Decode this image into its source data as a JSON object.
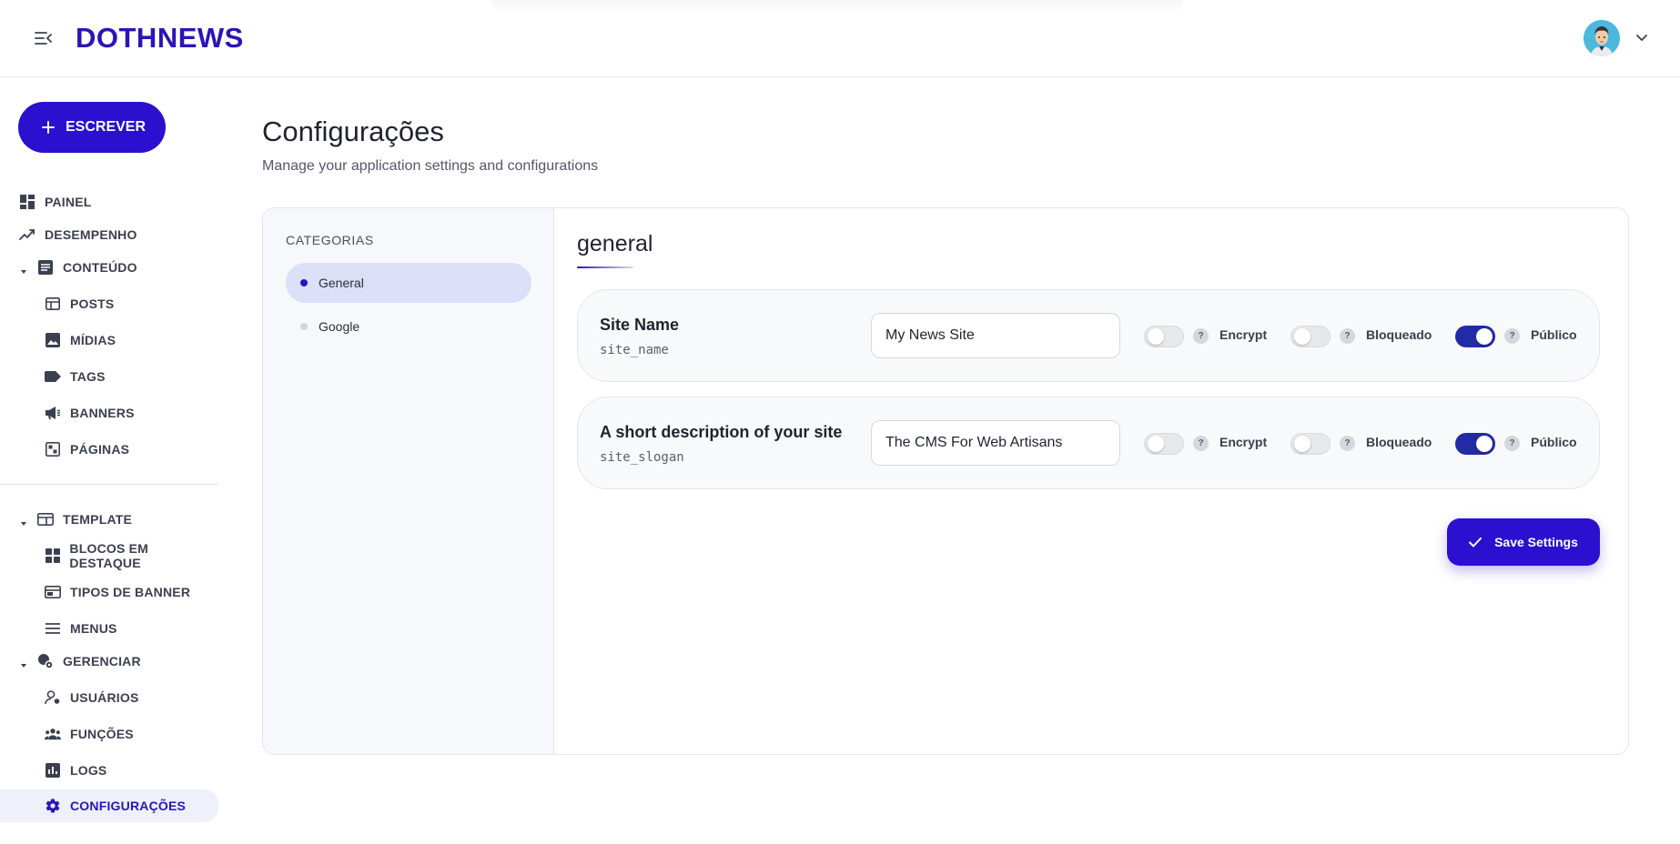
{
  "app": {
    "logo": "DOTHNEWS",
    "brand_color": "#2b14b8",
    "accent_color": "#2b10cf"
  },
  "topbar": {
    "menu_icon": "menu-collapse-icon",
    "avatar_icon": "user-avatar",
    "caret_icon": "chevron-down-icon"
  },
  "sidebar": {
    "write_button": "ESCREVER",
    "items": [
      {
        "label": "PAINEL",
        "icon": "dashboard-icon"
      },
      {
        "label": "DESEMPENHO",
        "icon": "trending-up-icon"
      },
      {
        "label": "CONTEÚDO",
        "icon": "article-icon"
      },
      {
        "label": "POSTS",
        "icon": "posts-icon"
      },
      {
        "label": "MÍDIAS",
        "icon": "image-icon"
      },
      {
        "label": "TAGS",
        "icon": "tag-icon"
      },
      {
        "label": "BANNERS",
        "icon": "megaphone-icon"
      },
      {
        "label": "PÁGINAS",
        "icon": "pages-icon"
      },
      {
        "label": "TEMPLATE",
        "icon": "template-icon"
      },
      {
        "label": "BLOCOS EM DESTAQUE",
        "icon": "blocks-icon"
      },
      {
        "label": "TIPOS DE BANNER",
        "icon": "banner-type-icon"
      },
      {
        "label": "MENUS",
        "icon": "menu-lines-icon"
      },
      {
        "label": "GERENCIAR",
        "icon": "manage-icon"
      },
      {
        "label": "USUÁRIOS",
        "icon": "user-icon"
      },
      {
        "label": "FUNÇÕES",
        "icon": "group-icon"
      },
      {
        "label": "LOGS",
        "icon": "logs-icon"
      },
      {
        "label": "CONFIGURAÇÕES",
        "icon": "gear-icon",
        "active": true
      }
    ]
  },
  "page": {
    "title": "Configurações",
    "subtitle": "Manage your application settings and configurations"
  },
  "categories": {
    "title": "CATEGORIAS",
    "items": [
      {
        "label": "General",
        "active": true
      },
      {
        "label": "Google",
        "active": false
      }
    ]
  },
  "section": {
    "title": "general"
  },
  "settings": [
    {
      "label": "Site Name",
      "key": "site_name",
      "value": "My News Site",
      "encrypt": {
        "label": "Encrypt",
        "on": false
      },
      "locked": {
        "label": "Bloqueado",
        "on": false
      },
      "public": {
        "label": "Público",
        "on": true
      }
    },
    {
      "label": "A short description of your site",
      "key": "site_slogan",
      "value": "The CMS For Web Artisans",
      "encrypt": {
        "label": "Encrypt",
        "on": false
      },
      "locked": {
        "label": "Bloqueado",
        "on": false
      },
      "public": {
        "label": "Público",
        "on": true
      }
    }
  ],
  "save_button": "Save Settings"
}
